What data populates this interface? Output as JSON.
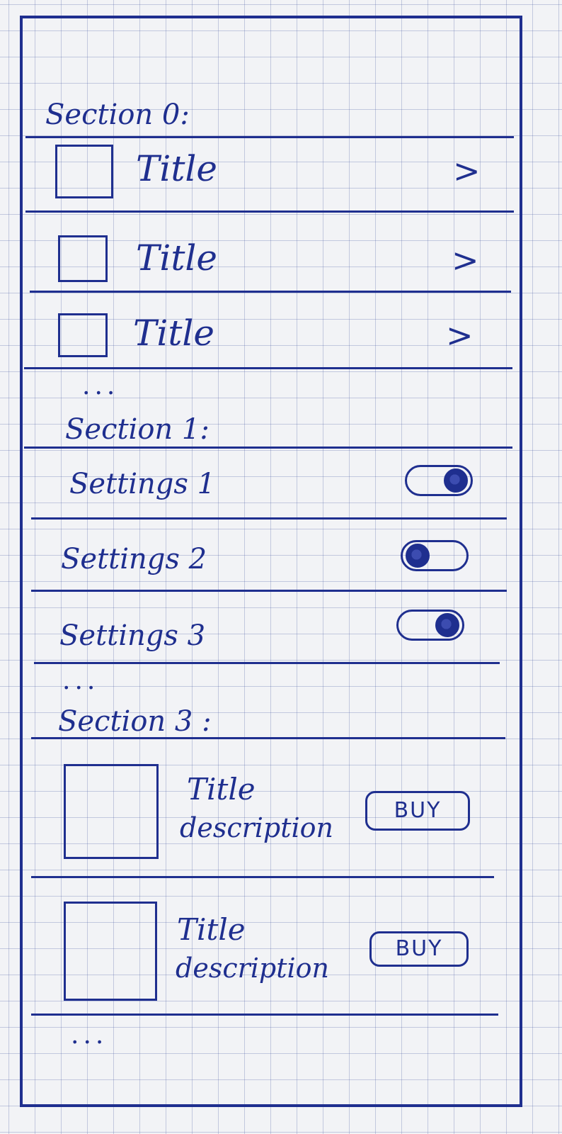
{
  "section0": {
    "header": "Section 0:",
    "items": [
      {
        "title": "Title",
        "chevron": ">"
      },
      {
        "title": "Title",
        "chevron": ">"
      },
      {
        "title": "Title",
        "chevron": ">"
      }
    ],
    "more": "..."
  },
  "section1": {
    "header": "Section 1:",
    "settings": [
      {
        "label": "Settings 1",
        "enabled": true
      },
      {
        "label": "Settings 2",
        "enabled": false
      },
      {
        "label": "Settings 3",
        "enabled": true
      }
    ],
    "more": "..."
  },
  "section3": {
    "header": "Section 3 :",
    "products": [
      {
        "title": "Title",
        "description": "description",
        "button": "BUY"
      },
      {
        "title": "Title",
        "description": "description",
        "button": "BUY"
      }
    ],
    "more": "..."
  },
  "colors": {
    "ink": "#1f2f8f",
    "paper": "#f2f3f6"
  }
}
